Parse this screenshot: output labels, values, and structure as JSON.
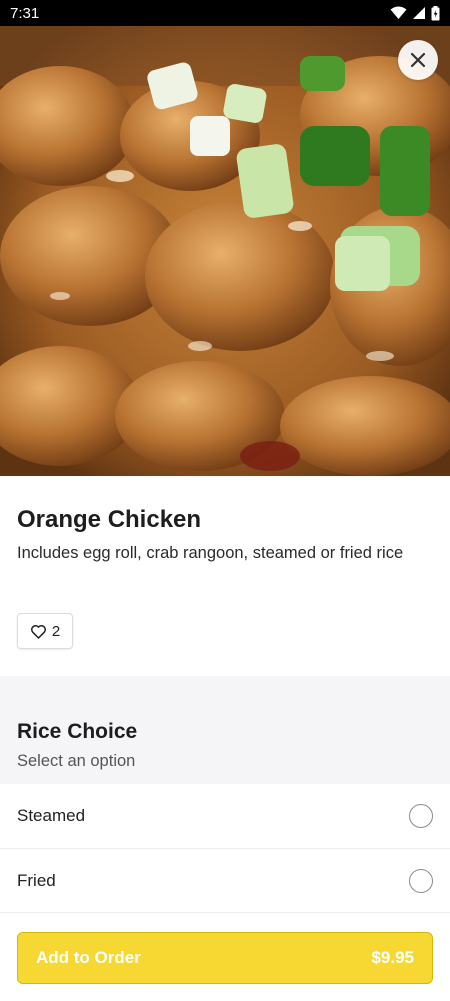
{
  "status_bar": {
    "time": "7:31"
  },
  "hero": {
    "image_alt": "orange-chicken-photo"
  },
  "close_icon": "close-icon",
  "item": {
    "title": "Orange Chicken",
    "description": "Includes egg roll, crab rangoon, steamed or fried rice",
    "like_count": "2"
  },
  "options": {
    "title": "Rice Choice",
    "subtitle": "Select an option",
    "choices": [
      {
        "label": "Steamed",
        "selected": false
      },
      {
        "label": "Fried",
        "selected": false
      }
    ]
  },
  "footer": {
    "add_label": "Add to Order",
    "price": "$9.95"
  },
  "colors": {
    "accent": "#f7d833",
    "accent_text": "#ffffff",
    "section_bg": "#f5f5f7"
  }
}
